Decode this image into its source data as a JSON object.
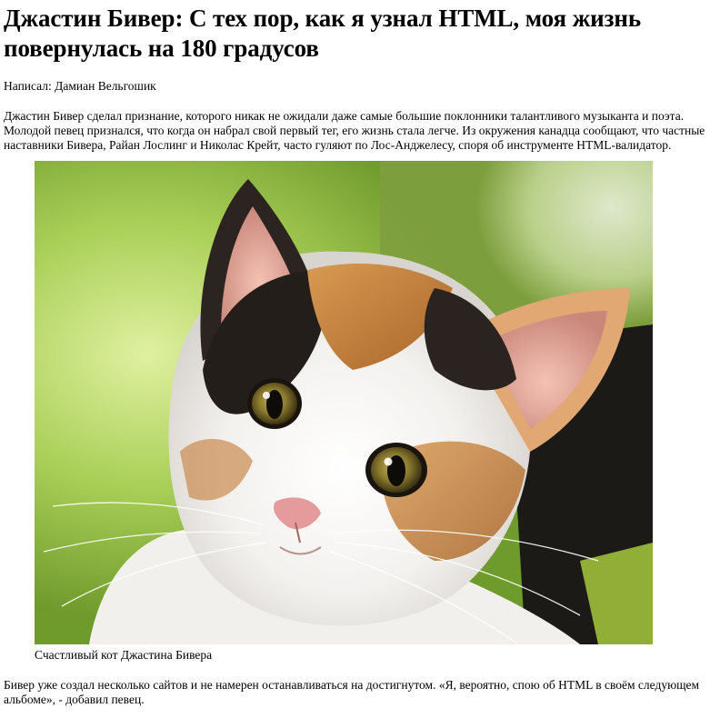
{
  "article": {
    "title": "Джастин Бивер: С тех пор, как я узнал HTML, моя жизнь повернулась на 180 градусов",
    "byline": "Написал: Дамиан Вельгошик",
    "intro": "Джастин Бивер сделал признание, которого никак не ожидали даже самые большие поклонники талантливого музыканта и поэта. Молодой певец признался, что когда он набрал свой первый тег, его жизнь стала легче. Из окружения канадца сообщают, что частные наставники Бивера, Райан Лослинг и Николас Крейт, часто гуляют по Лос-Анджелесу, споря об инструменте HTML-валидатор.",
    "figure": {
      "caption": "Счастливый кот Джастина Бивера",
      "image_subject": "calico-kitten-photo"
    },
    "outro": "Бивер уже создал несколько сайтов и не намерен останавливаться на достигнутом. «Я, вероятно, спою об HTML в своём следующем альбоме», - добавил певец."
  }
}
